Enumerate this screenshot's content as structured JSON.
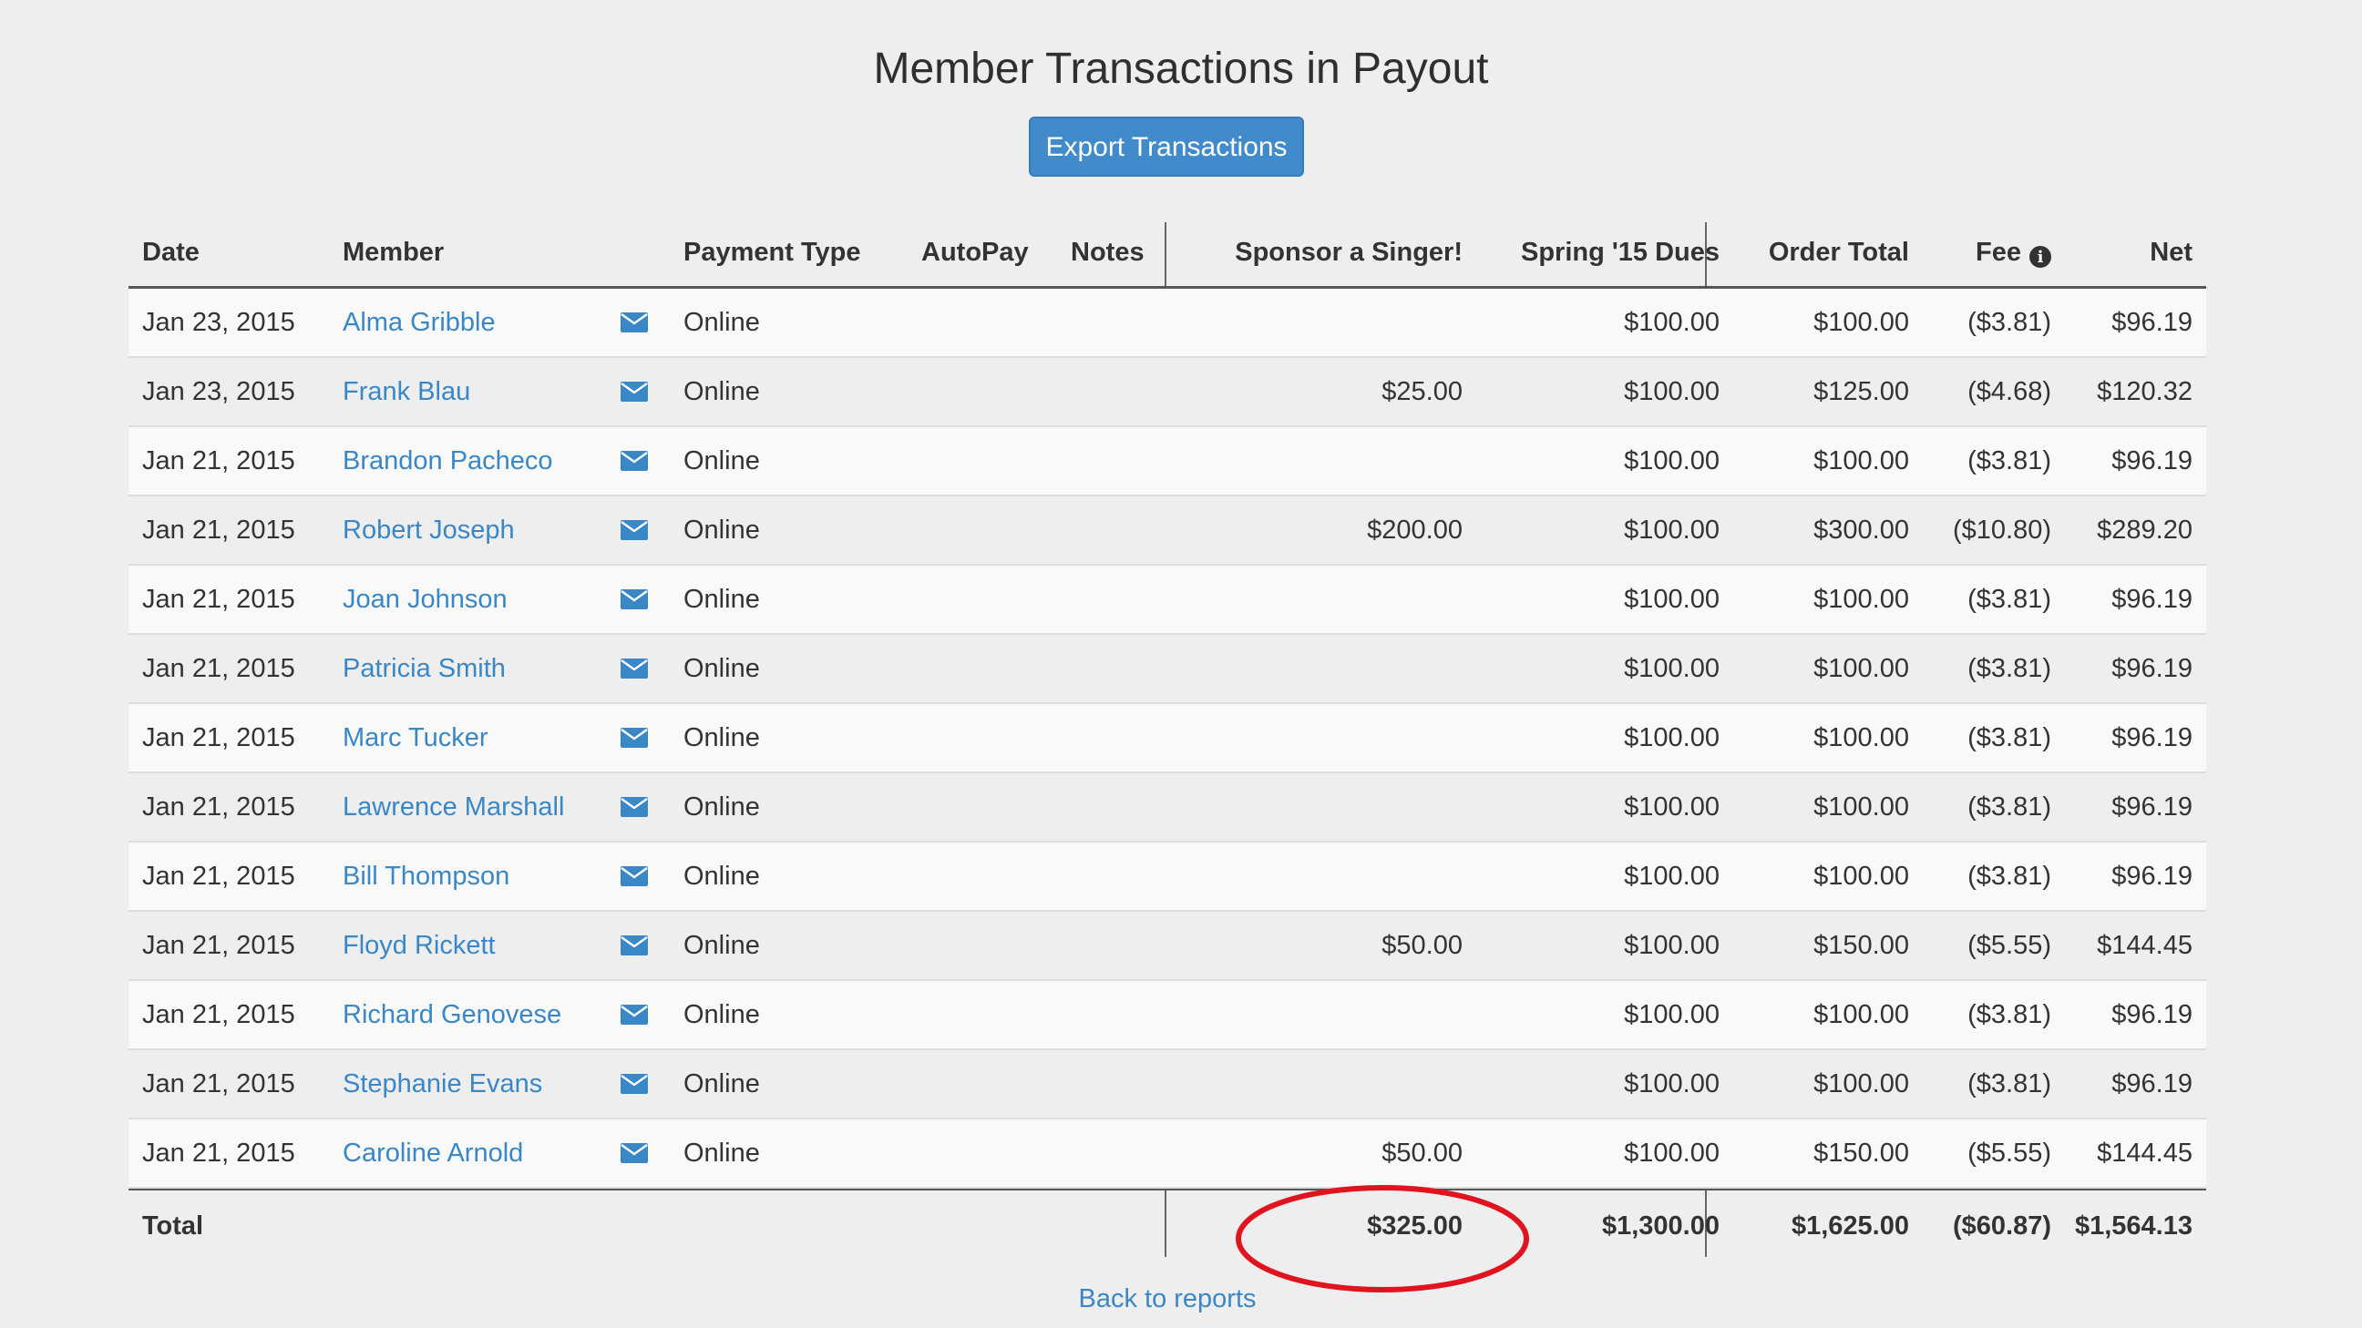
{
  "page": {
    "title": "Member Transactions in Payout",
    "export_label": "Export Transactions",
    "back_label": "Back to reports"
  },
  "colors": {
    "link": "#3a87c8",
    "button": "#428bca",
    "annotation": "#e0141e"
  },
  "table": {
    "headers": {
      "date": "Date",
      "member": "Member",
      "payment_type": "Payment Type",
      "autopay": "AutoPay",
      "notes": "Notes",
      "sponsor": "Sponsor a Singer!",
      "dues": "Spring '15 Dues",
      "order_total": "Order Total",
      "fee": "Fee",
      "net": "Net"
    },
    "fee_icon": "info-icon",
    "member_icon": "envelope-icon",
    "rows": [
      {
        "date": "Jan 23, 2015",
        "member": "Alma Gribble",
        "payment_type": "Online",
        "autopay": "",
        "notes": "",
        "sponsor": "",
        "dues": "$100.00",
        "order_total": "$100.00",
        "fee": "($3.81)",
        "net": "$96.19"
      },
      {
        "date": "Jan 23, 2015",
        "member": "Frank Blau",
        "payment_type": "Online",
        "autopay": "",
        "notes": "",
        "sponsor": "$25.00",
        "dues": "$100.00",
        "order_total": "$125.00",
        "fee": "($4.68)",
        "net": "$120.32"
      },
      {
        "date": "Jan 21, 2015",
        "member": "Brandon Pacheco",
        "payment_type": "Online",
        "autopay": "",
        "notes": "",
        "sponsor": "",
        "dues": "$100.00",
        "order_total": "$100.00",
        "fee": "($3.81)",
        "net": "$96.19"
      },
      {
        "date": "Jan 21, 2015",
        "member": "Robert Joseph",
        "payment_type": "Online",
        "autopay": "",
        "notes": "",
        "sponsor": "$200.00",
        "dues": "$100.00",
        "order_total": "$300.00",
        "fee": "($10.80)",
        "net": "$289.20"
      },
      {
        "date": "Jan 21, 2015",
        "member": "Joan Johnson",
        "payment_type": "Online",
        "autopay": "",
        "notes": "",
        "sponsor": "",
        "dues": "$100.00",
        "order_total": "$100.00",
        "fee": "($3.81)",
        "net": "$96.19"
      },
      {
        "date": "Jan 21, 2015",
        "member": "Patricia Smith",
        "payment_type": "Online",
        "autopay": "",
        "notes": "",
        "sponsor": "",
        "dues": "$100.00",
        "order_total": "$100.00",
        "fee": "($3.81)",
        "net": "$96.19"
      },
      {
        "date": "Jan 21, 2015",
        "member": "Marc Tucker",
        "payment_type": "Online",
        "autopay": "",
        "notes": "",
        "sponsor": "",
        "dues": "$100.00",
        "order_total": "$100.00",
        "fee": "($3.81)",
        "net": "$96.19"
      },
      {
        "date": "Jan 21, 2015",
        "member": "Lawrence Marshall",
        "payment_type": "Online",
        "autopay": "",
        "notes": "",
        "sponsor": "",
        "dues": "$100.00",
        "order_total": "$100.00",
        "fee": "($3.81)",
        "net": "$96.19"
      },
      {
        "date": "Jan 21, 2015",
        "member": "Bill Thompson",
        "payment_type": "Online",
        "autopay": "",
        "notes": "",
        "sponsor": "",
        "dues": "$100.00",
        "order_total": "$100.00",
        "fee": "($3.81)",
        "net": "$96.19"
      },
      {
        "date": "Jan 21, 2015",
        "member": "Floyd Rickett",
        "payment_type": "Online",
        "autopay": "",
        "notes": "",
        "sponsor": "$50.00",
        "dues": "$100.00",
        "order_total": "$150.00",
        "fee": "($5.55)",
        "net": "$144.45"
      },
      {
        "date": "Jan 21, 2015",
        "member": "Richard Genovese",
        "payment_type": "Online",
        "autopay": "",
        "notes": "",
        "sponsor": "",
        "dues": "$100.00",
        "order_total": "$100.00",
        "fee": "($3.81)",
        "net": "$96.19"
      },
      {
        "date": "Jan 21, 2015",
        "member": "Stephanie Evans",
        "payment_type": "Online",
        "autopay": "",
        "notes": "",
        "sponsor": "",
        "dues": "$100.00",
        "order_total": "$100.00",
        "fee": "($3.81)",
        "net": "$96.19"
      },
      {
        "date": "Jan 21, 2015",
        "member": "Caroline Arnold",
        "payment_type": "Online",
        "autopay": "",
        "notes": "",
        "sponsor": "$50.00",
        "dues": "$100.00",
        "order_total": "$150.00",
        "fee": "($5.55)",
        "net": "$144.45"
      }
    ],
    "totals": {
      "label": "Total",
      "sponsor": "$325.00",
      "dues": "$1,300.00",
      "order_total": "$1,625.00",
      "fee": "($60.87)",
      "net": "$1,564.13"
    }
  }
}
